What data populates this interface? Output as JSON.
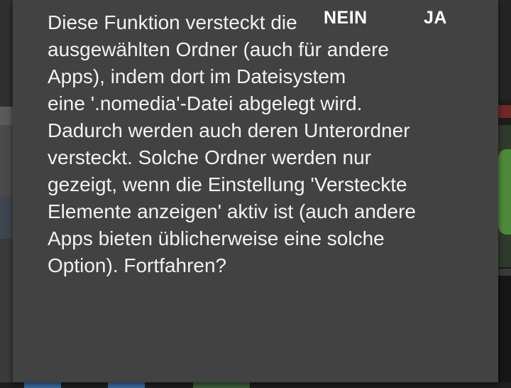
{
  "dialog": {
    "message_lines": [
      "Diese Funktion versteckt die",
      "ausgewählten Ordner (auch für andere",
      "Apps), indem dort im Dateisystem",
      "eine '.nomedia'-Datei abgelegt wird.",
      "Dadurch werden auch deren Unterordner",
      "versteckt. Solche Ordner werden nur",
      "gezeigt, wenn die Einstellung 'Versteckte",
      "Elemente anzeigen' aktiv ist (auch andere",
      "Apps bieten üblicherweise eine solche",
      "Option). Fortfahren?"
    ],
    "negative_label": "NEIN",
    "positive_label": "JA"
  },
  "colors": {
    "dialog_background": "#424242",
    "text": "#f2f2f2",
    "scrim": "#2a2a2a"
  }
}
